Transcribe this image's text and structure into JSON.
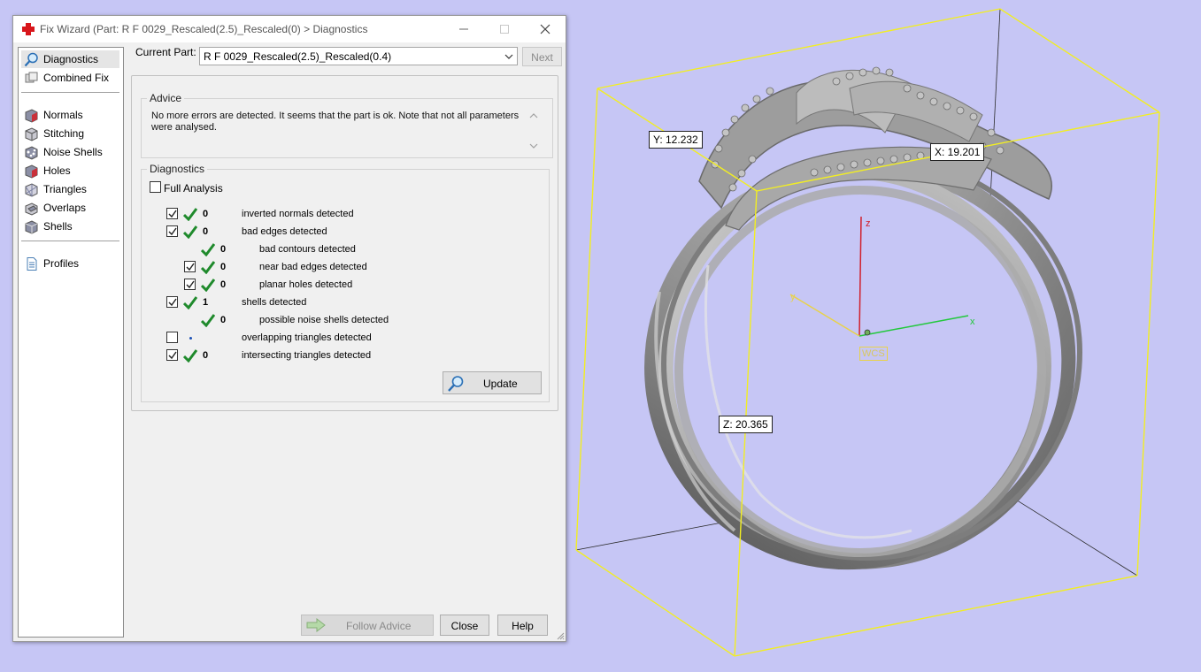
{
  "window": {
    "title": "Fix Wizard (Part: R F 0029_Rescaled(2.5)_Rescaled(0) > Diagnostics",
    "controls": [
      "minimize",
      "maximize",
      "close"
    ]
  },
  "nav": {
    "items": [
      {
        "label": "Diagnostics",
        "icon": "magnifier-icon",
        "active": true
      },
      {
        "label": "Combined Fix",
        "icon": "cube-stack-icon"
      },
      {
        "label": "Normals",
        "icon": "normals-cube-icon"
      },
      {
        "label": "Stitching",
        "icon": "stitching-cube-icon"
      },
      {
        "label": "Noise Shells",
        "icon": "noise-shells-icon"
      },
      {
        "label": "Holes",
        "icon": "holes-cube-icon"
      },
      {
        "label": "Triangles",
        "icon": "triangles-icon"
      },
      {
        "label": "Overlaps",
        "icon": "overlaps-icon"
      },
      {
        "label": "Shells",
        "icon": "shells-icon"
      },
      {
        "label": "Profiles",
        "icon": "profiles-document-icon"
      }
    ]
  },
  "current_part": {
    "label": "Current Part:",
    "value": "R F 0029_Rescaled(2.5)_Rescaled(0.4)"
  },
  "buttons": {
    "next": "Next",
    "update": "Update",
    "follow_advice": "Follow Advice",
    "close": "Close",
    "help": "Help"
  },
  "advice": {
    "title": "Advice",
    "text": "No more errors are detected. It seems that the part is ok. Note that not all parameters were analysed."
  },
  "diagnostics": {
    "title": "Diagnostics",
    "full_analysis": {
      "label": "Full Analysis",
      "checked": false
    },
    "rows": [
      {
        "count": "0",
        "label": "inverted normals detected",
        "checked": true,
        "indent": 0,
        "status": "ok"
      },
      {
        "count": "0",
        "label": "bad edges detected",
        "checked": true,
        "indent": 0,
        "status": "ok"
      },
      {
        "count": "0",
        "label": "bad contours detected",
        "indent": 1,
        "status": "ok"
      },
      {
        "count": "0",
        "label": "near bad edges detected",
        "checked": true,
        "indent": 1,
        "status": "ok"
      },
      {
        "count": "0",
        "label": "planar holes detected",
        "checked": true,
        "indent": 1,
        "status": "ok"
      },
      {
        "count": "1",
        "label": "shells detected",
        "checked": true,
        "indent": 0,
        "status": "ok"
      },
      {
        "count": "0",
        "label": "possible noise shells detected",
        "indent": 1,
        "status": "ok"
      },
      {
        "count": "",
        "label": "overlapping triangles detected",
        "checked": false,
        "indent": 0,
        "status": "not-analysed"
      },
      {
        "count": "0",
        "label": "intersecting triangles detected",
        "checked": true,
        "indent": 0,
        "status": "ok"
      }
    ]
  },
  "viewport": {
    "dimensions": {
      "x": "X: 19.201",
      "y": "Y: 12.232",
      "z": "Z: 20.365"
    },
    "axes": {
      "x": "x",
      "y": "y",
      "z": "z"
    },
    "wcs": "WCS",
    "colors": {
      "background": "#c6c6f5",
      "bbox": "#f2ee22",
      "x_axis": "#22c83c",
      "y_axis": "#e8d24a",
      "z_axis": "#d0202c"
    }
  }
}
